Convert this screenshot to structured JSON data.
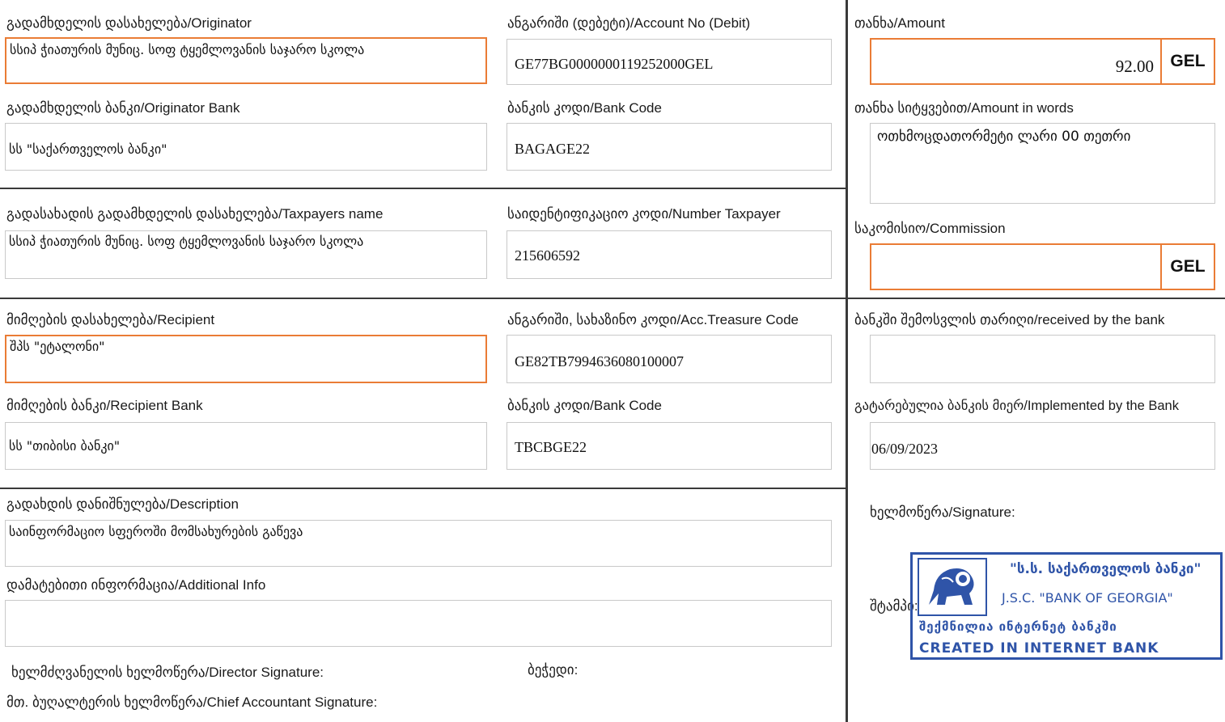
{
  "originator": {
    "label": "გადამხდელის დასახელება/Originator",
    "value": "სსიპ ჭიათურის მუნიც. სოფ ტყემლოვანის საჯარო სკოლა"
  },
  "account_debit": {
    "label": "ანგარიში (დებეტი)/Account No (Debit)",
    "value": "GE77BG0000000119252000GEL"
  },
  "amount": {
    "label": "თანხა/Amount",
    "value": "92.00",
    "currency": "GEL"
  },
  "originator_bank": {
    "label": "გადამხდელის ბანკი/Originator Bank",
    "value": "სს \"საქართველოს ბანკი\""
  },
  "originator_bank_code": {
    "label": "ბანკის კოდი/Bank Code",
    "value": "BAGAGE22"
  },
  "amount_words": {
    "label": "თანხა სიტყვებით/Amount in words",
    "value": "ოთხმოცდათორმეტი ლარი 00 თეთრი"
  },
  "taxpayer_name": {
    "label": "გადასახადის გადამხდელის დასახელება/Taxpayers name",
    "value": "სსიპ ჭიათურის მუნიც. სოფ ტყემლოვანის საჯარო სკოლა"
  },
  "taxpayer_number": {
    "label": "საიდენტიფიკაციო კოდი/Number Taxpayer",
    "value": "215606592"
  },
  "commission": {
    "label": "საკომისიო/Commission",
    "value": "",
    "currency": "GEL"
  },
  "recipient": {
    "label": "მიმღების დასახელება/Recipient",
    "value": "შპს \"ეტალონი\""
  },
  "treasury_code": {
    "label": "ანგარიში, სახაზინო კოდი/Acc.Treasure Code",
    "value": "GE82TB7994636080100007"
  },
  "received_by_bank": {
    "label": "ბანკში შემოსვლის თარიღი/received by the bank",
    "value": ""
  },
  "recipient_bank": {
    "label": "მიმღების ბანკი/Recipient Bank",
    "value": "სს \"თიბისი  ბანკი\""
  },
  "recipient_bank_code": {
    "label": "ბანკის კოდი/Bank Code",
    "value": "TBCBGE22"
  },
  "implemented_by_bank": {
    "label": "გატარებულია ბანკის მიერ/Implemented by the Bank",
    "value": "06/09/2023"
  },
  "description": {
    "label": "გადახდის დანიშნულება/Description",
    "value": "საინფორმაციო სფეროში მომსახურების გაწევა"
  },
  "additional_info": {
    "label": "დამატებითი ინფორმაცია/Additional Info",
    "value": ""
  },
  "signature_label": "ხელმოწერა/Signature:",
  "stamp_label": "შტამპი:",
  "director_signature_label": "ხელმძღვანელის ხელმოწერა/Director Signature:",
  "seal_label": "ბეჭედი:",
  "accountant_signature_label": "მთ. ბუღალტერის ხელმოწერა/Chief Accountant Signature:",
  "bank_stamp": {
    "line1": "\"ს.ს. საქართველოს ბანკი\"",
    "line2": "J.S.C. \"BANK OF GEORGIA\"",
    "line3": "შექმნილია ინტერნეტ ბანკში",
    "line4": "CREATED IN INTERNET BANK",
    "color": "#2f54a8"
  },
  "colors": {
    "highlight_border": "#ea7c35",
    "field_border": "#c9c9c9",
    "divider": "#3a3a3a"
  }
}
